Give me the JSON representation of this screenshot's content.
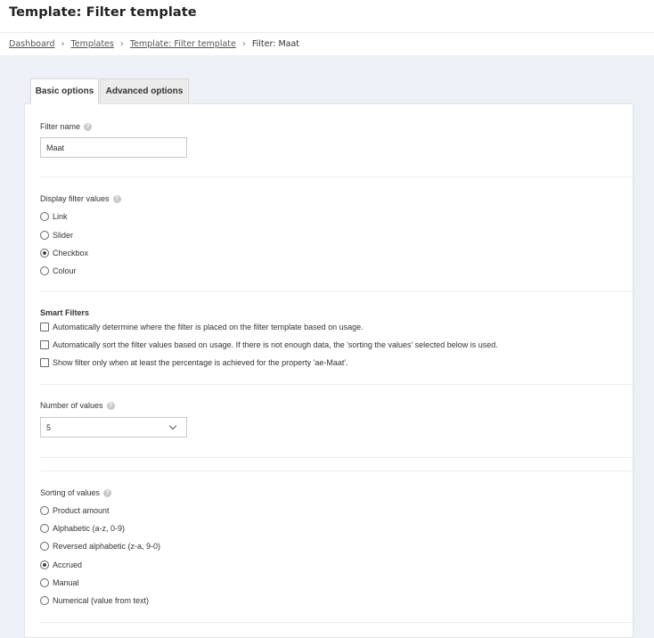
{
  "header": {
    "title": "Template: Filter template"
  },
  "breadcrumb": {
    "items": [
      {
        "label": "Dashboard",
        "link": true
      },
      {
        "label": "Templates",
        "link": true
      },
      {
        "label": "Template: Filter template",
        "link": true
      },
      {
        "label": "Filter: Maat",
        "link": false
      }
    ],
    "separator": "›"
  },
  "tabs": [
    {
      "label": "Basic options",
      "active": true
    },
    {
      "label": "Advanced options",
      "active": false
    }
  ],
  "filter_name": {
    "label": "Filter name",
    "value": "Maat"
  },
  "display_filter_values": {
    "label": "Display filter values",
    "options": [
      {
        "label": "Link",
        "checked": false
      },
      {
        "label": "Slider",
        "checked": false
      },
      {
        "label": "Checkbox",
        "checked": true
      },
      {
        "label": "Colour",
        "checked": false
      }
    ]
  },
  "smart_filters": {
    "label": "Smart Filters",
    "options": [
      {
        "label": "Automatically determine where the filter is placed on the filter template based on usage.",
        "checked": false
      },
      {
        "label": "Automatically sort the filter values based on usage. If there is not enough data, the 'sorting the values' selected below is used.",
        "checked": false
      },
      {
        "label": "Show filter only when at least the percentage is achieved for the property 'ae-Maat'.",
        "checked": false
      }
    ]
  },
  "number_of_values": {
    "label": "Number of values",
    "selected": "5"
  },
  "sorting_of_values": {
    "label": "Sorting of values",
    "options": [
      {
        "label": "Product amount",
        "checked": false
      },
      {
        "label": "Alphabetic (a-z, 0-9)",
        "checked": false
      },
      {
        "label": "Reversed alphabetic (z-a, 9-0)",
        "checked": false
      },
      {
        "label": "Accrued",
        "checked": true
      },
      {
        "label": "Manual",
        "checked": false
      },
      {
        "label": "Numerical (value from text)",
        "checked": false
      }
    ]
  },
  "icons": {
    "help": "question-mark-icon",
    "chevron": "chevron-down-icon"
  },
  "colors": {
    "background": "#eef0f7",
    "panel": "#ffffff",
    "text": "#333333",
    "border": "#c9c9c9"
  }
}
